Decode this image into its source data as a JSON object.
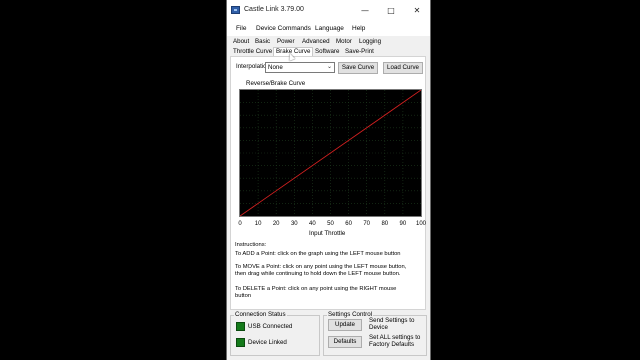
{
  "window": {
    "title": "Castle Link 3.79.00"
  },
  "menu": [
    "File",
    "Device Commands",
    "Language",
    "Help"
  ],
  "tabs_row1": [
    "About",
    "Basic",
    "Power",
    "Advanced",
    "Motor",
    "Logging"
  ],
  "tabs_row2": [
    "Throttle Curve",
    "Brake Curve",
    "Software",
    "Save-Print"
  ],
  "active_tab": "Brake Curve",
  "interpolation": {
    "label": "Interpolation:",
    "value": "None"
  },
  "buttons": {
    "save_curve": "Save Curve",
    "load_curve": "Load Curve",
    "update": "Update",
    "defaults": "Defaults"
  },
  "chart_data": {
    "type": "line",
    "title": "Reverse/Brake Curve",
    "xlabel": "Input Throttle",
    "ylabel": "",
    "xlim": [
      0,
      100
    ],
    "ylim": [
      0,
      100
    ],
    "x_ticks": [
      "0",
      "10",
      "20",
      "30",
      "40",
      "50",
      "60",
      "70",
      "80",
      "90",
      "100"
    ],
    "grid": true,
    "series": [
      {
        "x": [
          0,
          100
        ],
        "y": [
          0,
          100
        ],
        "color": "#d42020"
      }
    ]
  },
  "instructions": {
    "heading": "Instructions:",
    "add": "To ADD a Point: click on the graph using the LEFT mouse button",
    "move_1": "To MOVE a Point: click on any point using the LEFT mouse button,",
    "move_2": "then drag while continuing to hold down the LEFT mouse button.",
    "delete_1": "To DELETE a Point: click on any point using the RIGHT mouse",
    "delete_2": "button"
  },
  "connection_status": {
    "title": "Connection Status",
    "usb": "USB Connected",
    "device": "Device Linked",
    "led_color": "#147a1a"
  },
  "settings_control": {
    "title": "Settings Control",
    "update_desc_1": "Send Settings to",
    "update_desc_2": "Device",
    "defaults_desc_1": "Set ALL settings to",
    "defaults_desc_2": "Factory Defaults"
  }
}
